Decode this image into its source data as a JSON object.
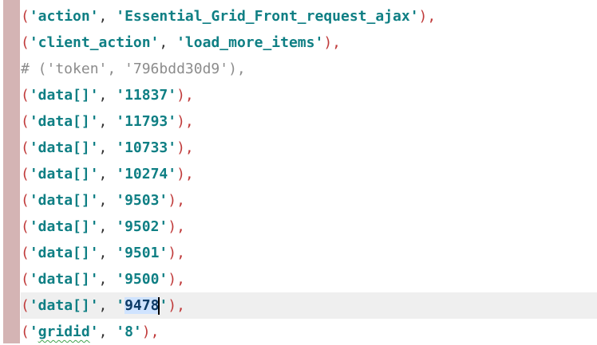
{
  "editor": {
    "lines": [
      {
        "open": "(",
        "key": "'action'",
        "sep": ", ",
        "val": "'Essential_Grid_Front_request_ajax'",
        "close": "),"
      },
      {
        "open": "(",
        "key": "'client_action'",
        "sep": ", ",
        "val": "'load_more_items'",
        "close": "),"
      },
      {
        "comment": "# ('token', '796bdd30d9'),"
      },
      {
        "open": "(",
        "key": "'data[]'",
        "sep": ", ",
        "val": "'11837'",
        "close": "),"
      },
      {
        "open": "(",
        "key": "'data[]'",
        "sep": ", ",
        "val": "'11793'",
        "close": "),"
      },
      {
        "open": "(",
        "key": "'data[]'",
        "sep": ", ",
        "val": "'10733'",
        "close": "),"
      },
      {
        "open": "(",
        "key": "'data[]'",
        "sep": ", ",
        "val": "'10274'",
        "close": "),"
      },
      {
        "open": "(",
        "key": "'data[]'",
        "sep": ", ",
        "val": "'9503'",
        "close": "),"
      },
      {
        "open": "(",
        "key": "'data[]'",
        "sep": ", ",
        "val": "'9502'",
        "close": "),"
      },
      {
        "open": "(",
        "key": "'data[]'",
        "sep": ", ",
        "val": "'9501'",
        "close": "),"
      },
      {
        "open": "(",
        "key": "'data[]'",
        "sep": ", ",
        "val": "'9500'",
        "close": "),"
      },
      {
        "open": "(",
        "key": "'data[]'",
        "sep": ", ",
        "val_pre": "'",
        "val_sel": "9478",
        "val_post": "'",
        "close": "),"
      },
      {
        "open": "(",
        "key_pre": "'",
        "key_sq": "gridid",
        "key_post": "'",
        "sep": ", ",
        "val": "'8'",
        "close": "),"
      }
    ]
  },
  "colors": {
    "gutter": "#d4b4b4",
    "string": "#0f7f84",
    "paren": "#c03a3a",
    "comment": "#8c8c8c",
    "current_line": "#efefef",
    "selection": "#cfe3ff"
  }
}
